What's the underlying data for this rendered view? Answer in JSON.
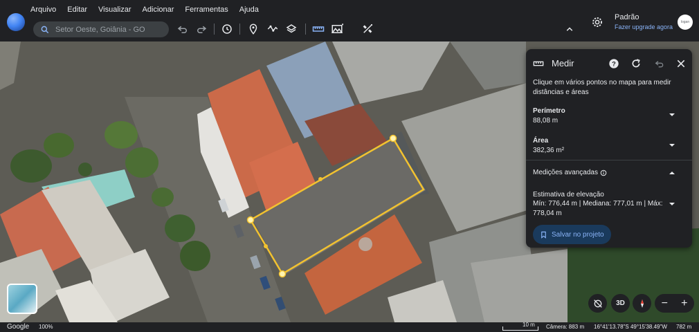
{
  "menu": [
    "Arquivo",
    "Editar",
    "Visualizar",
    "Adicionar",
    "Ferramentas",
    "Ajuda"
  ],
  "search": {
    "placeholder": "Setor Oeste, Goiânia - GO"
  },
  "account": {
    "name": "Padrão",
    "upgrade": "Fazer upgrade agora",
    "avatar": "logan"
  },
  "measure": {
    "title": "Medir",
    "instructions": "Clique em vários pontos no mapa para medir distâncias e áreas",
    "perimeter_label": "Perímetro",
    "perimeter_value": "88,08 m",
    "area_label": "Área",
    "area_value": "382,36 m²",
    "advanced_label": "Medições avançadas",
    "elevation_label": "Estimativa de elevação",
    "elevation_value": "Mín: 776,44 m | Mediana: 777,01 m | Máx: 778,04 m",
    "save_label": "Salvar no projeto"
  },
  "controls": {
    "view3d": "3D"
  },
  "status": {
    "brand": "Google",
    "zoom": "100%",
    "scale": "10 m",
    "camera": "Câmera: 883 m",
    "coords": "16°41'13.78\"S 49°15'38.49\"W",
    "elevation": "782 m"
  },
  "icons": [
    "search-icon",
    "undo-icon",
    "redo-icon",
    "history-icon",
    "place-icon",
    "path-icon",
    "layers-icon",
    "ruler-icon",
    "image-icon",
    "satellite-icon",
    "chevron-up-icon",
    "settings-icon",
    "help-icon",
    "refresh-icon",
    "close-icon",
    "info-icon",
    "bookmark-icon",
    "compass-icon",
    "no-rotate-icon"
  ],
  "colors": {
    "accent": "#8ab4f8",
    "measure_line": "#f2c230",
    "panel_bg": "#202124"
  }
}
